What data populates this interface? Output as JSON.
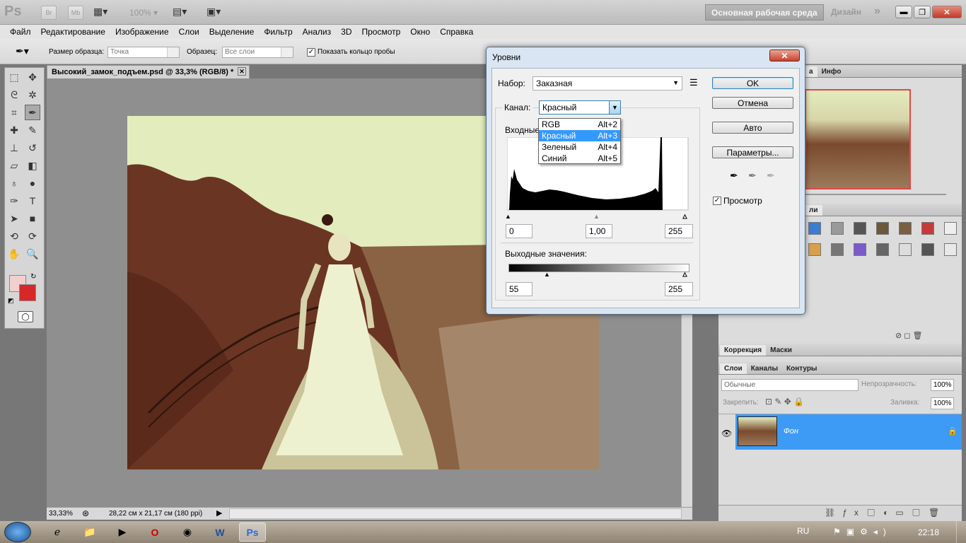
{
  "appbar": {
    "logo": "Ps",
    "br": "Br",
    "mb": "Mb",
    "zoom": "100%",
    "workspace_active": "Основная рабочая среда",
    "workspace_design": "Дизайн",
    "more": "»"
  },
  "menu": [
    "Файл",
    "Редактирование",
    "Изображение",
    "Слои",
    "Выделение",
    "Фильтр",
    "Анализ",
    "3D",
    "Просмотр",
    "Окно",
    "Справка"
  ],
  "options": {
    "sample_size_label": "Размер образца:",
    "sample_size_value": "Точка",
    "sample_label": "Образец:",
    "sample_value": "Все слои",
    "show_ring_checked": "✓",
    "show_ring_label": "Показать кольцо пробы"
  },
  "document": {
    "tab_title": "Высокий_замок_подъем.psd @ 33,3% (RGB/8) *",
    "zoom": "33,33%",
    "doc_info": "28,22 см x 21,17 см (180 ppi)"
  },
  "levels": {
    "title": "Уровни",
    "preset_label": "Набор:",
    "preset_value": "Заказная",
    "channel_label": "Канал:",
    "channel_value": "Красный",
    "input_label": "Входные",
    "input_black": "0",
    "input_gamma": "1,00",
    "input_white": "255",
    "output_label": "Выходные значения:",
    "output_black": "55",
    "output_white": "255",
    "ok": "OK",
    "cancel": "Отмена",
    "auto": "Авто",
    "params": "Параметры...",
    "preview_label": "Просмотр",
    "preview_checked": "✓",
    "output_black_fraction": 0.216,
    "channels": [
      {
        "name": "RGB",
        "shortcut": "Alt+2"
      },
      {
        "name": "Красный",
        "shortcut": "Alt+3"
      },
      {
        "name": "Зеленый",
        "shortcut": "Alt+4"
      },
      {
        "name": "Синий",
        "shortcut": "Alt+5"
      }
    ]
  },
  "panels": {
    "navigator_tab_hidden": "а",
    "info_tab": "Инфо",
    "styles_tab_hidden": "ли",
    "correction_tab": "Коррекция",
    "masks_tab": "Маски",
    "layers_tab": "Слои",
    "channels_tab": "Каналы",
    "paths_tab": "Контуры",
    "blend_mode": "Обычные",
    "opacity_label": "Непрозрачность:",
    "opacity_value": "100%",
    "lock_label": "Закрепить:",
    "fill_label": "Заливка:",
    "fill_value": "100%",
    "layer_name": "Фон"
  },
  "taskbar": {
    "lang": "RU",
    "time": "22:18"
  },
  "colors": {
    "foreground": "#f2cfcf",
    "background": "#d62828",
    "layer_selected": "#3d9bf5",
    "accent_ok": "#3c7fb1"
  }
}
